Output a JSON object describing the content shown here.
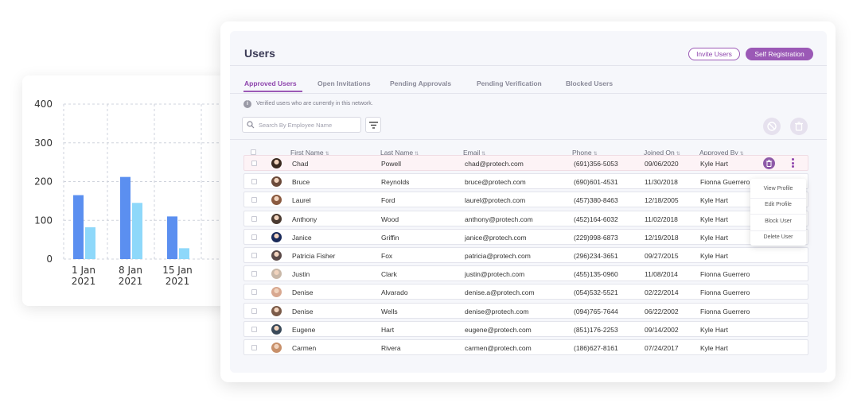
{
  "chart_data": {
    "type": "bar",
    "categories": [
      "1 Jan 2021",
      "8 Jan 2021",
      "15 Jan 2021"
    ],
    "category_lines": [
      [
        "1 Jan",
        "2021"
      ],
      [
        "8 Jan",
        "2021"
      ],
      [
        "15 Jan",
        "2021"
      ]
    ],
    "truncated_tick": "2",
    "series": [
      {
        "values": [
          165,
          212,
          110
        ],
        "color": "#5b8ff0"
      },
      {
        "values": [
          82,
          145,
          28
        ],
        "color": "#8ed8fa"
      }
    ],
    "yticks": [
      0,
      100,
      200,
      300,
      400
    ],
    "ylim": [
      0,
      400
    ],
    "grid": true
  },
  "header": {
    "title": "Users",
    "invite_label": "Invite Users",
    "self_reg_label": "Self Registration"
  },
  "tabs": [
    {
      "label": "Approved Users",
      "active": true
    },
    {
      "label": "Open Invitations",
      "active": false
    },
    {
      "label": "Pending Approvals",
      "active": false
    },
    {
      "label": "Pending Verification",
      "active": false
    },
    {
      "label": "Blocked Users",
      "active": false
    }
  ],
  "info": {
    "text": "Verified users who are currently in this network."
  },
  "search": {
    "placeholder": "Search By Employee Name",
    "value": ""
  },
  "columns": [
    "First Name",
    "Last Name",
    "Email",
    "Phone",
    "Joined On",
    "Approved By"
  ],
  "sort_glyph": "⇅",
  "rows": [
    {
      "first": "Chad",
      "last": "Powell",
      "email": "chad@protech.com",
      "phone": "(691)356-5053",
      "joined": "09/06/2020",
      "approved_by": "Kyle Hart",
      "avatar_color": "#3a2a20"
    },
    {
      "first": "Bruce",
      "last": "Reynolds",
      "email": "bruce@protech.com",
      "phone": "(690)601-4531",
      "joined": "11/30/2018",
      "approved_by": "Fionna Guerrero",
      "avatar_color": "#6b4a3a"
    },
    {
      "first": "Laurel",
      "last": "Ford",
      "email": "laurel@protech.com",
      "phone": "(457)380-8463",
      "joined": "12/18/2005",
      "approved_by": "Kyle Hart",
      "avatar_color": "#8a5a40"
    },
    {
      "first": "Anthony",
      "last": "Wood",
      "email": "anthony@protech.com",
      "phone": "(452)164-6032",
      "joined": "11/02/2018",
      "approved_by": "Kyle Hart",
      "avatar_color": "#4a3a30"
    },
    {
      "first": "Janice",
      "last": "Griffin",
      "email": "janice@protech.com",
      "phone": "(229)998-6873",
      "joined": "12/19/2018",
      "approved_by": "Kyle Hart",
      "avatar_color": "#1a2a5a"
    },
    {
      "first": "Patricia Fisher",
      "last": "Fox",
      "email": "patricia@protech.com",
      "phone": "(296)234-3651",
      "joined": "09/27/2015",
      "approved_by": "Kyle Hart",
      "avatar_color": "#5a4a48"
    },
    {
      "first": "Justin",
      "last": "Clark",
      "email": "justin@protech.com",
      "phone": "(455)135-0960",
      "joined": "11/08/2014",
      "approved_by": "Fionna Guerrero",
      "avatar_color": "#c9b8a8"
    },
    {
      "first": "Denise",
      "last": "Alvarado",
      "email": "denise.a@protech.com",
      "phone": "(054)532-5521",
      "joined": "02/22/2014",
      "approved_by": "Fionna Guerrero",
      "avatar_color": "#d8a890"
    },
    {
      "first": "Denise",
      "last": "Wells",
      "email": "denise@protech.com",
      "phone": "(094)765-7644",
      "joined": "06/22/2002",
      "approved_by": "Fionna Guerrero",
      "avatar_color": "#7a5a48"
    },
    {
      "first": "Eugene",
      "last": "Hart",
      "email": "eugene@protech.com",
      "phone": "(851)176-2253",
      "joined": "09/14/2002",
      "approved_by": "Kyle Hart",
      "avatar_color": "#3a4a5a"
    },
    {
      "first": "Carmen",
      "last": "Rivera",
      "email": "carmen@protech.com",
      "phone": "(186)627-8161",
      "joined": "07/24/2017",
      "approved_by": "Kyle Hart",
      "avatar_color": "#c8906a"
    }
  ],
  "row_menu": [
    "View Profile",
    "Edit Profile",
    "Block User",
    "Delete User"
  ],
  "colors": {
    "accent": "#9b59b6",
    "accent_dark": "#8e44ad"
  }
}
